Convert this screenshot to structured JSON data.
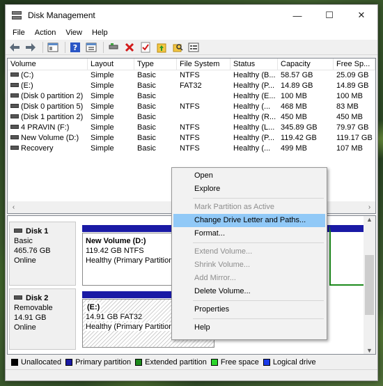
{
  "window": {
    "title": "Disk Management",
    "controls": {
      "minimize": "—",
      "maximize": "☐",
      "close": "✕"
    }
  },
  "menu": [
    "File",
    "Action",
    "View",
    "Help"
  ],
  "toolbar_icons": [
    "back-arrow-icon",
    "forward-arrow-icon",
    "console-tree-icon",
    "help-icon",
    "properties-icon",
    "connect-icon",
    "delete-icon",
    "check-icon",
    "folder-up-icon",
    "search-folder-icon",
    "list-icon"
  ],
  "volume_table": {
    "columns": [
      "Volume",
      "Layout",
      "Type",
      "File System",
      "Status",
      "Capacity",
      "Free Sp..."
    ],
    "rows": [
      [
        "(C:)",
        "Simple",
        "Basic",
        "NTFS",
        "Healthy (B...",
        "58.57 GB",
        "25.09 GB"
      ],
      [
        "(E:)",
        "Simple",
        "Basic",
        "FAT32",
        "Healthy (P...",
        "14.89 GB",
        "14.89 GB"
      ],
      [
        "(Disk 0 partition 2)",
        "Simple",
        "Basic",
        "",
        "Healthy (E...",
        "100 MB",
        "100 MB"
      ],
      [
        "(Disk 0 partition 5)",
        "Simple",
        "Basic",
        "NTFS",
        "Healthy (...",
        "468 MB",
        "83 MB"
      ],
      [
        "(Disk 1 partition 2)",
        "Simple",
        "Basic",
        "",
        "Healthy (R...",
        "450 MB",
        "450 MB"
      ],
      [
        "4 PRAVIN (F:)",
        "Simple",
        "Basic",
        "NTFS",
        "Healthy (L...",
        "345.89 GB",
        "79.97 GB"
      ],
      [
        "New Volume (D:)",
        "Simple",
        "Basic",
        "NTFS",
        "Healthy (P...",
        "119.42 GB",
        "119.17 GB"
      ],
      [
        "Recovery",
        "Simple",
        "Basic",
        "NTFS",
        "Healthy (...",
        "499 MB",
        "107 MB"
      ]
    ]
  },
  "disks": [
    {
      "name": "Disk 1",
      "type": "Basic",
      "size": "465.76 GB",
      "state": "Online",
      "partition": {
        "label": "New Volume  (D:)",
        "size_fs": "119.42 GB NTFS",
        "status": "Healthy (Primary Partition)"
      }
    },
    {
      "name": "Disk 2",
      "type": "Removable",
      "size": "14.91 GB",
      "state": "Online",
      "partition": {
        "label": "(E:)",
        "size_fs": "14.91 GB FAT32",
        "status": "Healthy (Primary Partition)"
      }
    }
  ],
  "legend": [
    {
      "label": "Unallocated",
      "color": "#000000"
    },
    {
      "label": "Primary partition",
      "color": "#1a1aa5"
    },
    {
      "label": "Extended partition",
      "color": "#1c8a1c"
    },
    {
      "label": "Free space",
      "color": "#2bd42b"
    },
    {
      "label": "Logical drive",
      "color": "#1a3ae8"
    }
  ],
  "context_menu": {
    "open": "Open",
    "explore": "Explore",
    "mark_active": "Mark Partition as Active",
    "change_letter": "Change Drive Letter and Paths...",
    "format": "Format...",
    "extend": "Extend Volume...",
    "shrink": "Shrink Volume...",
    "add_mirror": "Add Mirror...",
    "delete": "Delete Volume...",
    "properties": "Properties",
    "help": "Help"
  }
}
